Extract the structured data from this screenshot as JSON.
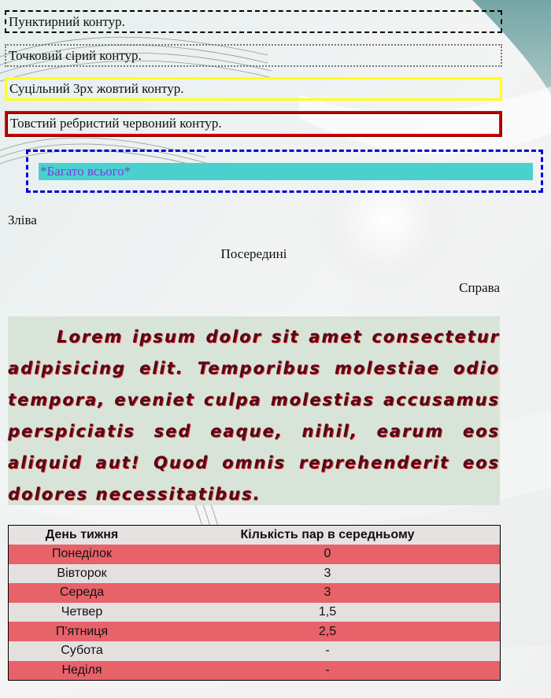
{
  "boxes": [
    "Пунктирний контур.",
    "Точковий сірий контур.",
    "Суцільний 3px жовтий контур.",
    "Товстий ребристий червоний контур."
  ],
  "highlight_text": "*Багато всього*",
  "align": {
    "left": "Зліва",
    "center": "Посередині",
    "right": "Справа"
  },
  "lorem": "Lorem ipsum dolor sit amet consectetur adipisicing elit. Temporibus molestiae odio tempora, eveniet culpa molestias accusamus perspiciatis sed eaque, nihil, earum eos aliquid aut! Quod omnis reprehenderit eos dolores necessitatibus.",
  "table": {
    "headers": [
      "День тижня",
      "Кількість пар в середньому"
    ],
    "rows": [
      [
        "Понеділок",
        "0"
      ],
      [
        "Вівторок",
        "3"
      ],
      [
        "Середа",
        "3"
      ],
      [
        "Четвер",
        "1,5"
      ],
      [
        "П'ятниця",
        "2,5"
      ],
      [
        "Субота",
        "-"
      ],
      [
        "Неділя",
        "-"
      ]
    ]
  },
  "colors": {
    "highlight_bg": "#4ad1cf",
    "highlight_text": "#7a3ee0",
    "row_pink": "#e8626a",
    "row_light": "#e4e0e0",
    "lorem_bg": "#d8e4d8"
  }
}
